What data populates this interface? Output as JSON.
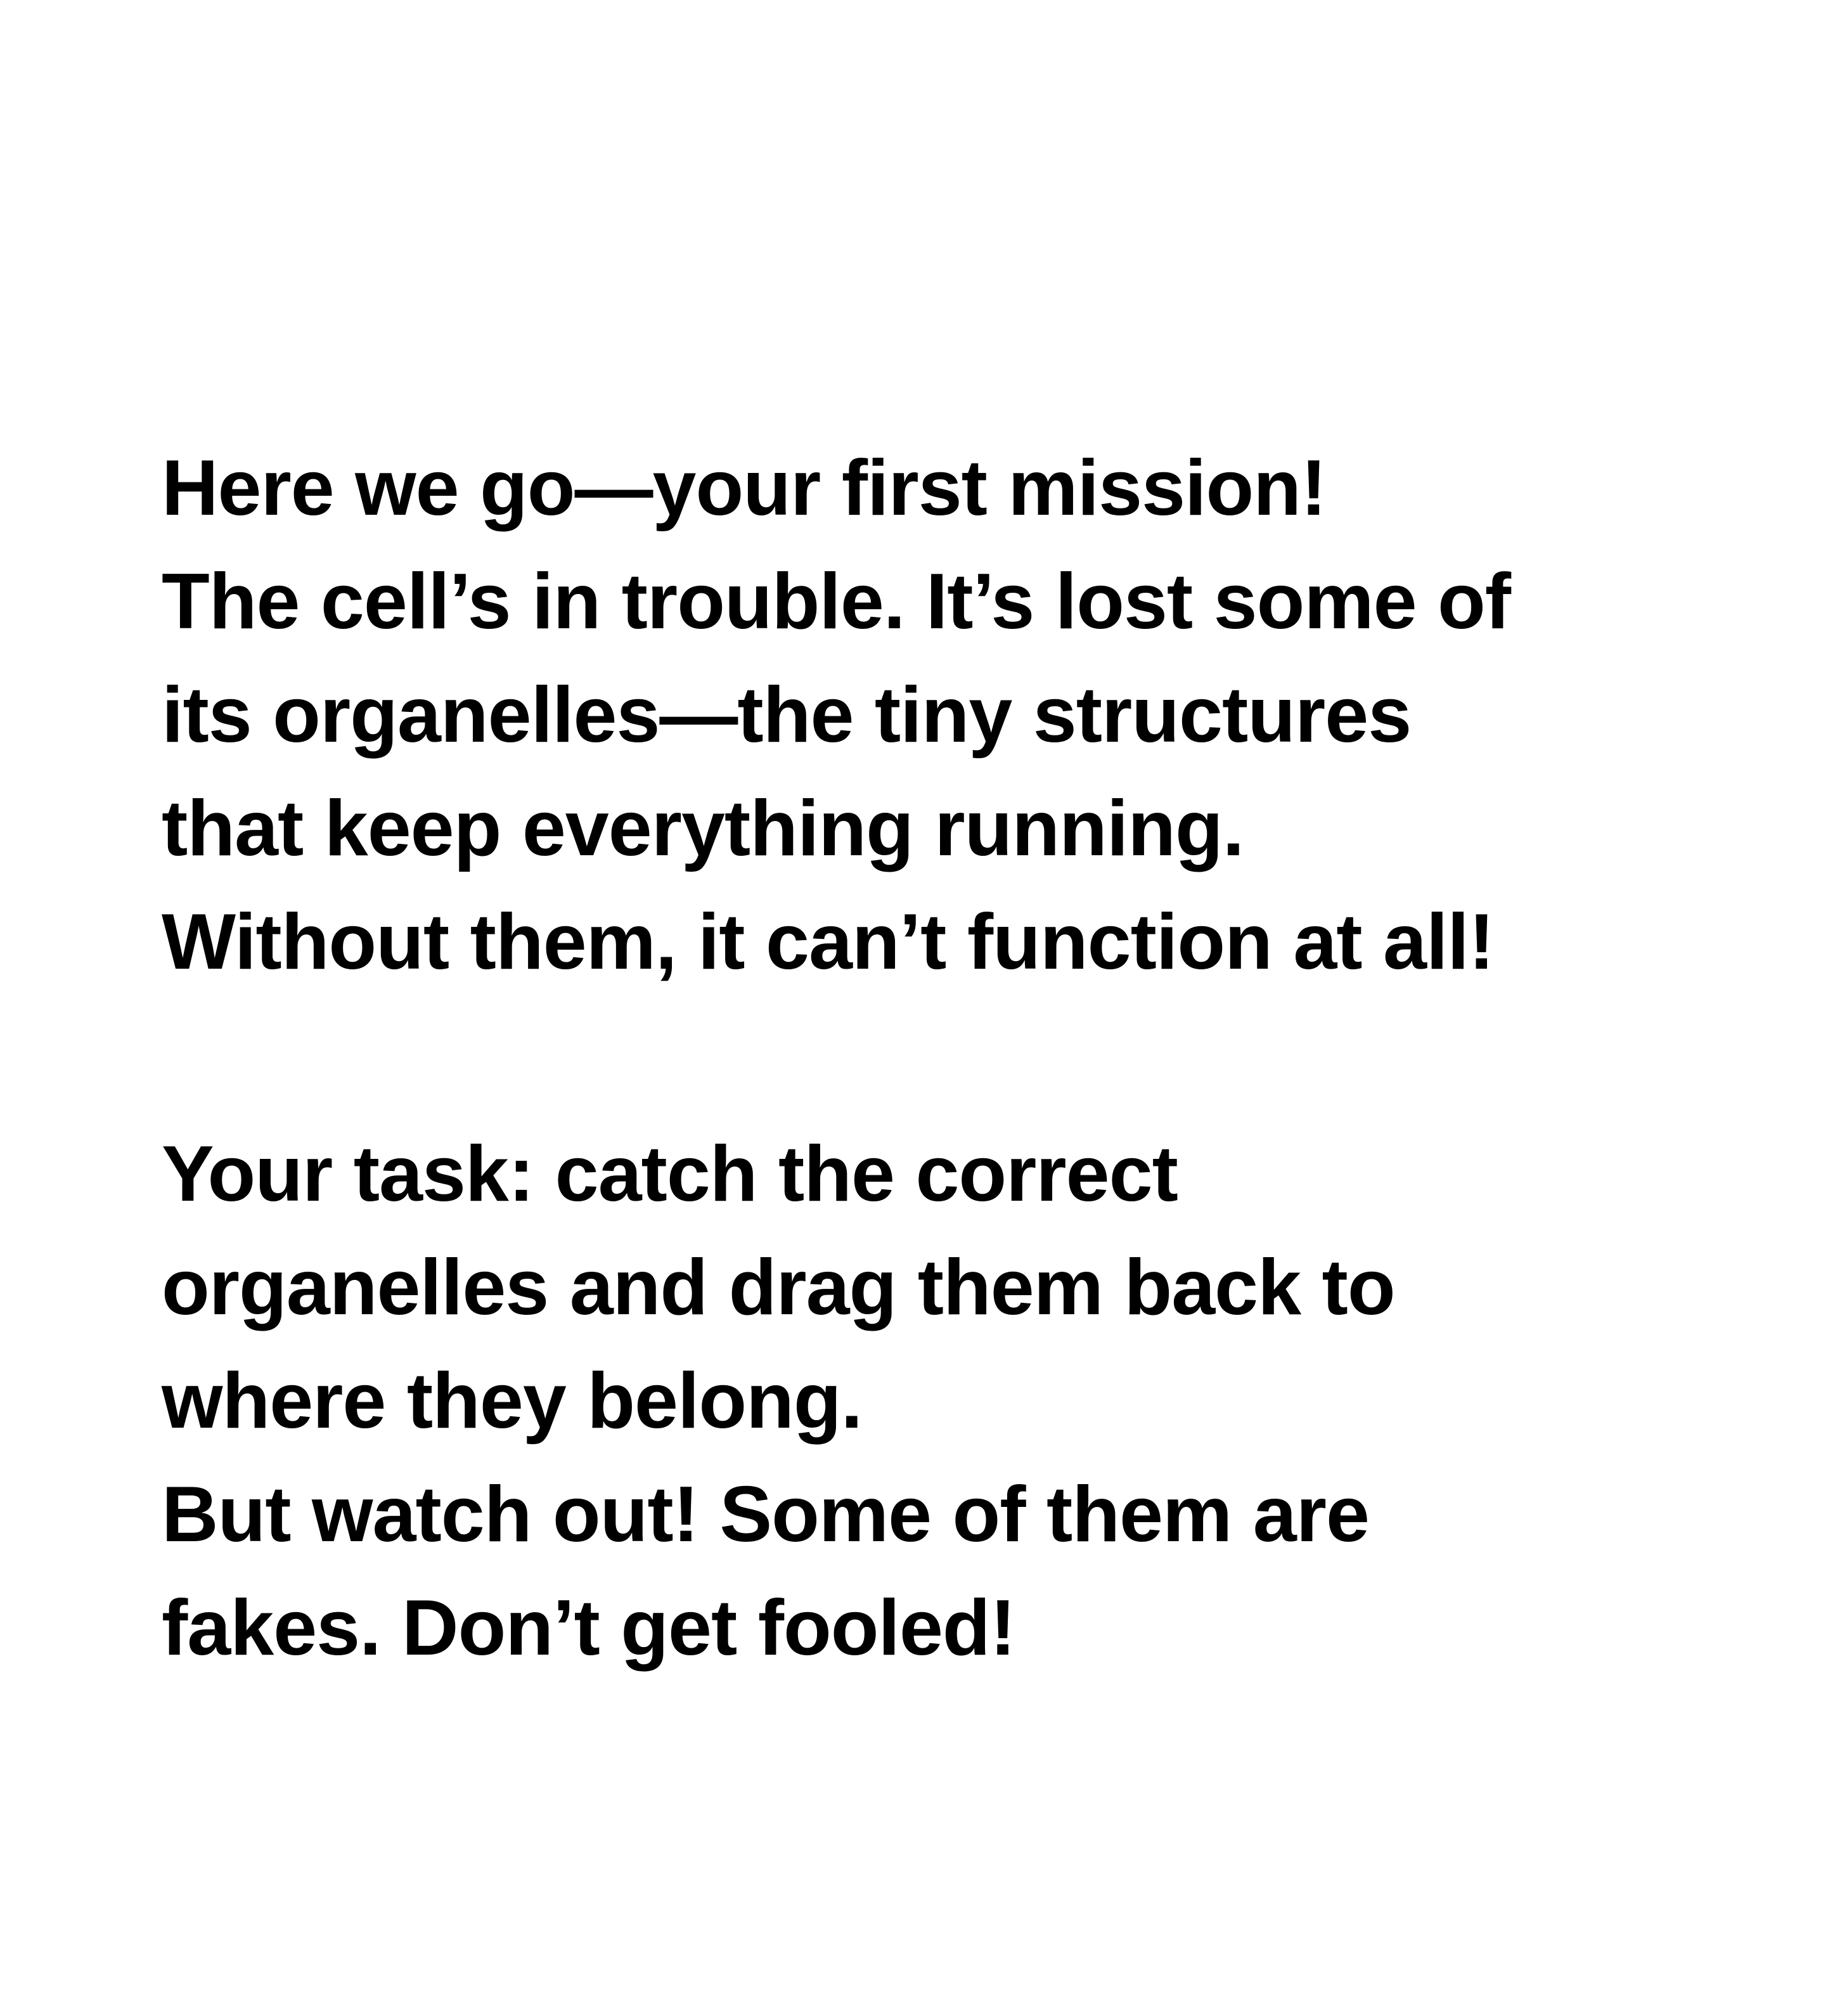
{
  "paragraphs": [
    {
      "lines": [
        "Here we go—your first mission!",
        "The cell’s in trouble. It’s lost some of",
        "its organelles—the tiny structures",
        "that keep everything running.",
        "Without them, it can’t function at all!"
      ]
    },
    {
      "lines": [
        "Your task: catch the correct",
        "organelles and drag them back to",
        "where they belong.",
        "But watch out! Some of them are",
        "fakes. Don’t get fooled!"
      ]
    }
  ]
}
